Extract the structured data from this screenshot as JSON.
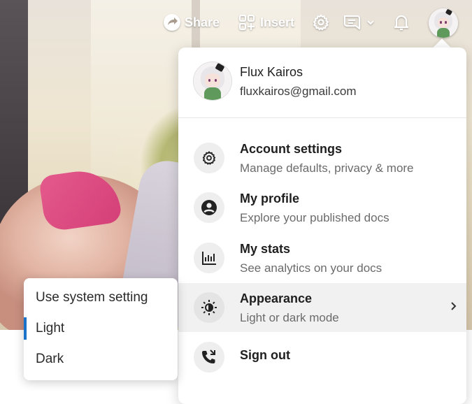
{
  "toolbar": {
    "share_label": "Share",
    "insert_label": "Insert"
  },
  "account": {
    "name": "Flux Kairos",
    "email": "fluxkairos@gmail.com"
  },
  "menu": {
    "items": [
      {
        "title": "Account settings",
        "subtitle": "Manage defaults, privacy & more",
        "icon": "gear-icon"
      },
      {
        "title": "My profile",
        "subtitle": "Explore your published docs",
        "icon": "user-circle-icon"
      },
      {
        "title": "My stats",
        "subtitle": "See analytics on your docs",
        "icon": "bar-chart-icon"
      },
      {
        "title": "Appearance",
        "subtitle": "Light or dark mode",
        "icon": "half-sun-icon"
      },
      {
        "title": "Sign out",
        "subtitle": "",
        "icon": "sign-out-icon"
      }
    ]
  },
  "appearance_options": [
    {
      "label": "Use system setting"
    },
    {
      "label": "Light",
      "selected": true
    },
    {
      "label": "Dark"
    }
  ],
  "colors": {
    "selection_accent": "#1a73c8"
  }
}
